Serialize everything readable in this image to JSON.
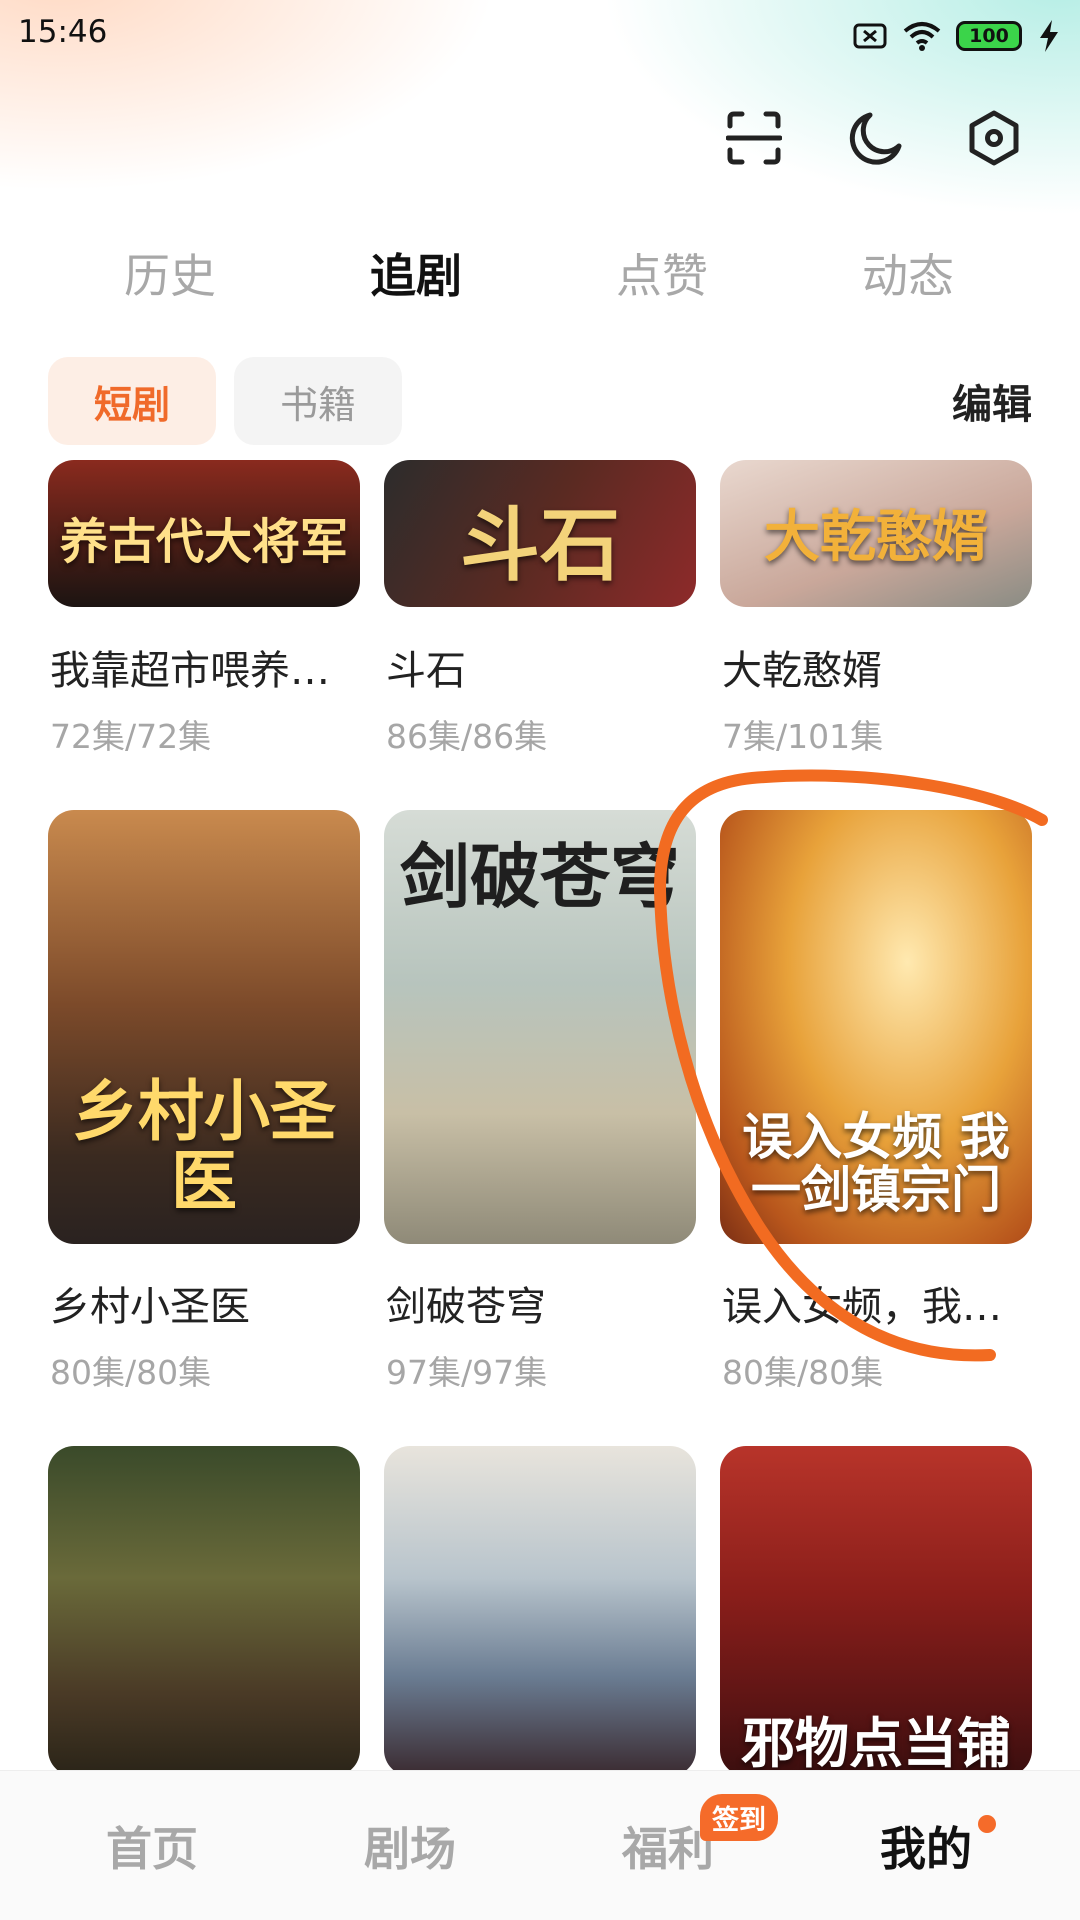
{
  "status_bar": {
    "time": "15:46",
    "battery": "100"
  },
  "header": {
    "icons": [
      "scan-icon",
      "moon-icon",
      "settings-icon"
    ]
  },
  "tabs": [
    {
      "label": "历史",
      "active": false
    },
    {
      "label": "追剧",
      "active": true
    },
    {
      "label": "点赞",
      "active": false
    },
    {
      "label": "动态",
      "active": false
    }
  ],
  "filters": {
    "items": [
      "短剧",
      "书籍"
    ],
    "active": "短剧",
    "edit_label": "编辑"
  },
  "cards": [
    {
      "title": "我靠超市喂养…",
      "episodes": "72集/72集",
      "poster_text": "养古代大将军"
    },
    {
      "title": "斗石",
      "episodes": "86集/86集",
      "poster_text": "斗石"
    },
    {
      "title": "大乾憨婿",
      "episodes": "7集/101集",
      "poster_text": "大乾憨婿"
    },
    {
      "title": "乡村小圣医",
      "episodes": "80集/80集",
      "poster_text": "乡村小圣医"
    },
    {
      "title": "剑破苍穹",
      "episodes": "97集/97集",
      "poster_text": "剑破苍穹"
    },
    {
      "title": "误入女频，我…",
      "episodes": "80集/80集",
      "poster_text": "误入女频 我一剑镇宗门"
    },
    {
      "title": "",
      "episodes": "",
      "poster_text": ""
    },
    {
      "title": "",
      "episodes": "",
      "poster_text": ""
    },
    {
      "title": "",
      "episodes": "",
      "poster_text": "邪物点当铺"
    }
  ],
  "bottom_nav": [
    {
      "label": "首页",
      "active": false
    },
    {
      "label": "剧场",
      "active": false
    },
    {
      "label": "福利",
      "active": false,
      "badge": "签到"
    },
    {
      "label": "我的",
      "active": true
    }
  ],
  "colors": {
    "accent": "#f06a2a",
    "annotation": "#f26b21"
  }
}
